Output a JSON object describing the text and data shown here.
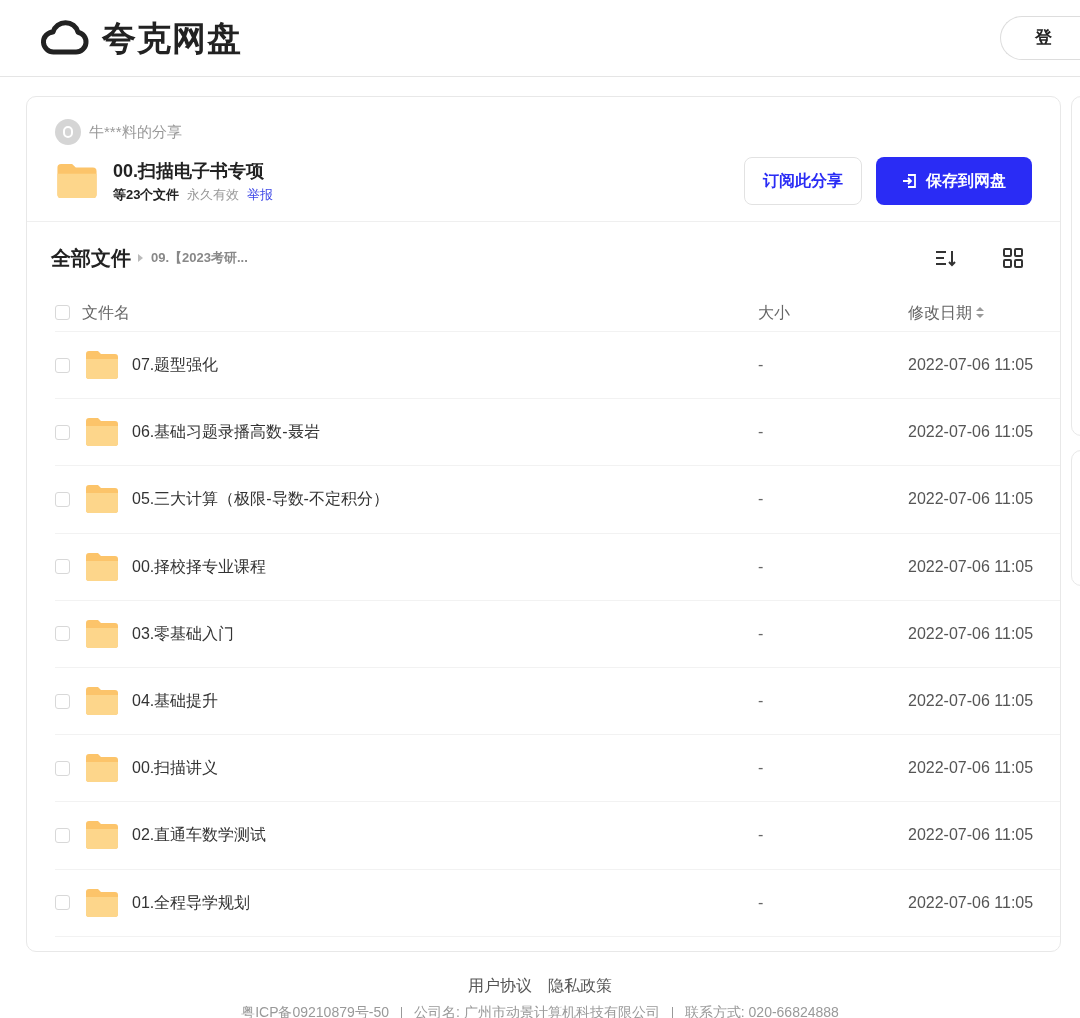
{
  "header": {
    "logo_text": "夸克网盘",
    "login_button": "登"
  },
  "share": {
    "owner": "牛***料的分享",
    "title": "00.扫描电子书专项",
    "file_count": "等23个文件",
    "validity": "永久有效",
    "report_link": "举报",
    "subscribe_button": "订阅此分享",
    "save_button": "保存到网盘"
  },
  "breadcrumb": {
    "root": "全部文件",
    "current": "09.【2023考研..."
  },
  "table": {
    "all_checked": false,
    "columns": [
      "文件名",
      "大小",
      "修改日期"
    ],
    "rows": [
      {
        "name": "07.题型强化",
        "size": "-",
        "modified": "2022-07-06 11:05",
        "checked": false
      },
      {
        "name": "06.基础习题录播高数-聂岩",
        "size": "-",
        "modified": "2022-07-06 11:05",
        "checked": false
      },
      {
        "name": "05.三大计算（极限-导数-不定积分）",
        "size": "-",
        "modified": "2022-07-06 11:05",
        "checked": false
      },
      {
        "name": "00.择校择专业课程",
        "size": "-",
        "modified": "2022-07-06 11:05",
        "checked": false
      },
      {
        "name": "03.零基础入门",
        "size": "-",
        "modified": "2022-07-06 11:05",
        "checked": false
      },
      {
        "name": "04.基础提升",
        "size": "-",
        "modified": "2022-07-06 11:05",
        "checked": false
      },
      {
        "name": "00.扫描讲义",
        "size": "-",
        "modified": "2022-07-06 11:05",
        "checked": false
      },
      {
        "name": "02.直通车数学测试",
        "size": "-",
        "modified": "2022-07-06 11:05",
        "checked": false
      },
      {
        "name": "01.全程导学规划",
        "size": "-",
        "modified": "2022-07-06 11:05",
        "checked": false
      }
    ]
  },
  "footer": {
    "links": [
      "用户协议",
      "隐私政策"
    ],
    "info": [
      "粤ICP备09210879号-50",
      "公司名: 广州市动景计算机科技有限公司",
      "联系方式: 020-66824888"
    ]
  }
}
